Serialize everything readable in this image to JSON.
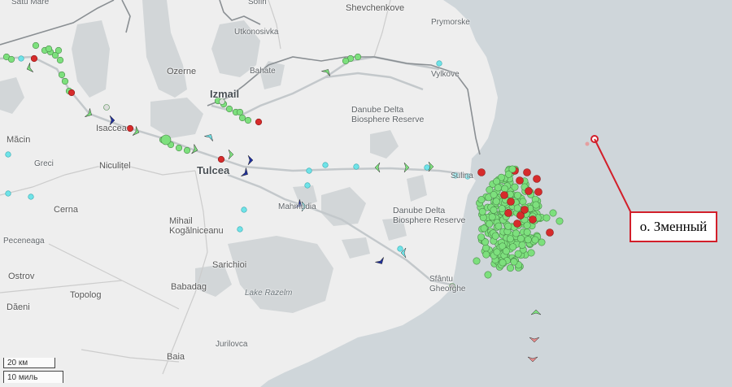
{
  "places": [
    {
      "key": "shevchenkove",
      "label": "Shevchenkove"
    },
    {
      "key": "primorske",
      "label": "Prymorske"
    },
    {
      "key": "utkonosivka",
      "label": "Utkonosivka"
    },
    {
      "key": "ozerne",
      "label": "Ozerne"
    },
    {
      "key": "bahate",
      "label": "Bahate"
    },
    {
      "key": "izmail",
      "label": "Izmail"
    },
    {
      "key": "vylkove",
      "label": "Vylkove"
    },
    {
      "key": "isaccea",
      "label": "Isaccea"
    },
    {
      "key": "macin",
      "label": "Măcin"
    },
    {
      "key": "greci",
      "label": "Greci"
    },
    {
      "key": "niculitel",
      "label": "Niculițel"
    },
    {
      "key": "tulcea",
      "label": "Tulcea"
    },
    {
      "key": "sulina",
      "label": "Sulina"
    },
    {
      "key": "mahmudia",
      "label": "Mahmudia"
    },
    {
      "key": "cerna",
      "label": "Cerna"
    },
    {
      "key": "mihail",
      "label": "Mihail Kogălniceanu"
    },
    {
      "key": "peceneaga",
      "label": "Peceneaga"
    },
    {
      "key": "sarichioi",
      "label": "Sarichioi"
    },
    {
      "key": "ostrov",
      "label": "Ostrov"
    },
    {
      "key": "babadag",
      "label": "Babadag"
    },
    {
      "key": "topolog",
      "label": "Topolog"
    },
    {
      "key": "sfantu",
      "label": "Sfântu Gheorghe"
    },
    {
      "key": "daeni",
      "label": "Dăeni"
    },
    {
      "key": "lakerazelm",
      "label": "Lake Razelm"
    },
    {
      "key": "jurilovca",
      "label": "Jurilovca"
    },
    {
      "key": "baia",
      "label": "Baia"
    },
    {
      "key": "saltmare",
      "label": "Satu Mare"
    },
    {
      "key": "sofiri",
      "label": "Sofiri"
    }
  ],
  "reserves": [
    {
      "key": "north",
      "line1": "Danube Delta",
      "line2": "Biosphere Reserve"
    },
    {
      "key": "south",
      "line1": "Danube Delta",
      "line2": "Biosphere Reserve"
    }
  ],
  "callout": {
    "label": "о. Зменный"
  },
  "scale": {
    "metric": "20 км",
    "imperial": "10 миль"
  },
  "colors": {
    "sea": "#cfd6da",
    "land": "#eeeeee",
    "water": "#d2d6d8",
    "border": "#8a8f93",
    "road": "#c7c7c7",
    "vessel_green": "#7de07d",
    "vessel_red": "#d62b2b",
    "vessel_cyan": "#6fe3e8",
    "vessel_navy": "#1f2f9a",
    "callout": "#d21f2a"
  }
}
